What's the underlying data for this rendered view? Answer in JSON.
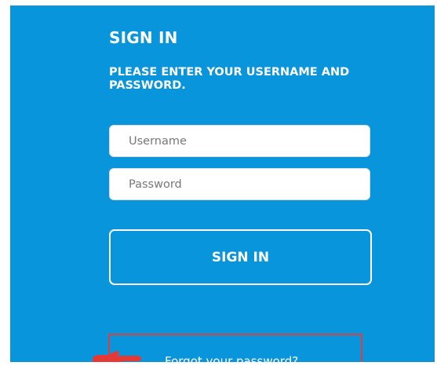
{
  "signin_form": {
    "title": "SIGN IN",
    "subtitle": "PLEASE ENTER YOUR USERNAME AND PASSWORD.",
    "username_placeholder": "Username",
    "password_placeholder": "Password",
    "submit_label": "SIGN IN",
    "forgot_password_label": "Forgot your password?"
  },
  "colors": {
    "panel_background": "#0995dc",
    "text": "#ffffff",
    "highlight_box": "#d9403f",
    "pointer_hand": "#e53935"
  },
  "icons": {
    "pointer": "pointing-hand-icon"
  }
}
